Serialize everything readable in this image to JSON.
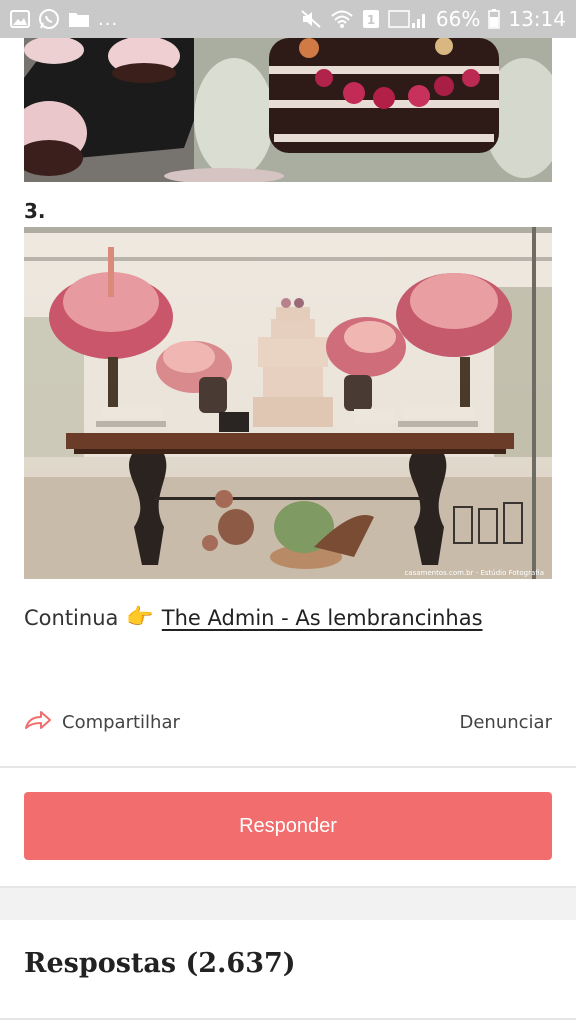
{
  "status_bar": {
    "dots": "...",
    "battery_percent": "66%",
    "time": "13:14",
    "left_icons": [
      "gallery-icon",
      "whatsapp-icon",
      "folder-icon"
    ],
    "right_icons": [
      "mute-icon",
      "wifi-icon",
      "sim-icon",
      "signal-icon",
      "battery-icon"
    ]
  },
  "post": {
    "item_number": "3.",
    "continue_label": "Continua",
    "continue_link": "The Admin - As lembrancinhas",
    "photo_credit": "casamentos.com.br - Estúdio Fotografia"
  },
  "actions": {
    "share_label": "Compartilhar",
    "report_label": "Denunciar"
  },
  "reply_button": "Responder",
  "answers": {
    "title": "Respostas (2.637)"
  },
  "colors": {
    "accent": "#f26d6d",
    "status_bar": "#c9c9c9"
  }
}
